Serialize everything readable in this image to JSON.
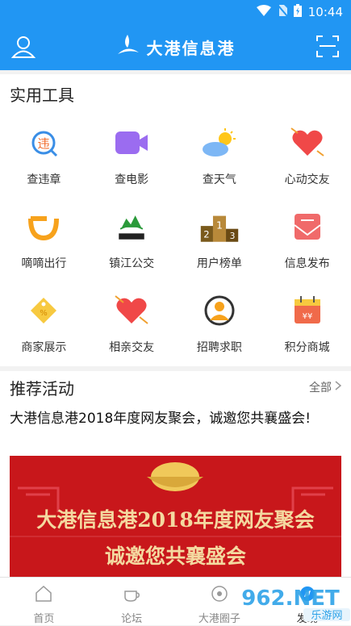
{
  "status": {
    "time": "10:44"
  },
  "header": {
    "title": "大港信息港",
    "left_icon": "user-icon",
    "right_icon": "scan-icon"
  },
  "tools": {
    "title": "实用工具",
    "items": [
      {
        "label": "查违章",
        "icon": "traffic-violation-icon"
      },
      {
        "label": "查电影",
        "icon": "movie-icon"
      },
      {
        "label": "查天气",
        "icon": "weather-icon"
      },
      {
        "label": "心动交友",
        "icon": "heart-icon"
      },
      {
        "label": "嘀嘀出行",
        "icon": "didi-icon"
      },
      {
        "label": "镇江公交",
        "icon": "bus-logo-icon"
      },
      {
        "label": "用户榜单",
        "icon": "podium-icon"
      },
      {
        "label": "信息发布",
        "icon": "mail-icon"
      },
      {
        "label": "商家展示",
        "icon": "tag-icon"
      },
      {
        "label": "相亲交友",
        "icon": "heart-arrow-icon"
      },
      {
        "label": "招聘求职",
        "icon": "job-icon"
      },
      {
        "label": "积分商城",
        "icon": "shop-icon"
      }
    ]
  },
  "activity": {
    "title": "推荐活动",
    "all_label": "全部",
    "headline": "大港信息港2018年度网友聚会，诚邀您共襄盛会!",
    "banner_line1": "大港信息港2018年度网友聚会",
    "banner_line2": "诚邀您共襄盛会"
  },
  "tabbar": [
    {
      "label": "首页",
      "icon": "home-icon"
    },
    {
      "label": "论坛",
      "icon": "cup-icon"
    },
    {
      "label": "大港圈子",
      "icon": "circle-icon"
    },
    {
      "label": "发现",
      "icon": "discover-icon"
    }
  ],
  "watermark": {
    "text": "962.NET",
    "sub": "乐游网"
  },
  "colors": {
    "primary": "#2196f3",
    "banner_red": "#c8171b",
    "gold": "#f4d9a0"
  }
}
